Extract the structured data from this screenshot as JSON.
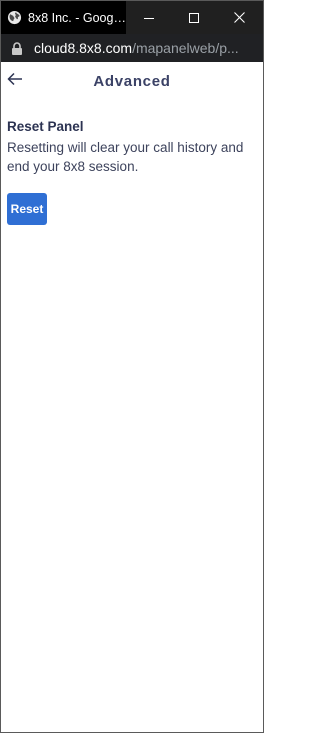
{
  "window": {
    "tab_title": "8x8 Inc. - Googl...",
    "controls": {
      "minimize": "minimize-icon",
      "maximize": "maximize-icon",
      "close": "close-icon"
    }
  },
  "address_bar": {
    "host": "cloud8.8x8.com",
    "path": "/mapanelweb/p..."
  },
  "header": {
    "title": "Advanced"
  },
  "reset_section": {
    "title": "Reset Panel",
    "description": "Resetting will clear your call history and end your 8x8 session.",
    "button_label": "Reset"
  },
  "colors": {
    "accent": "#2f6fd4",
    "title_text": "#3b4266",
    "titlebar": "#000000",
    "addressbar": "#202124"
  }
}
